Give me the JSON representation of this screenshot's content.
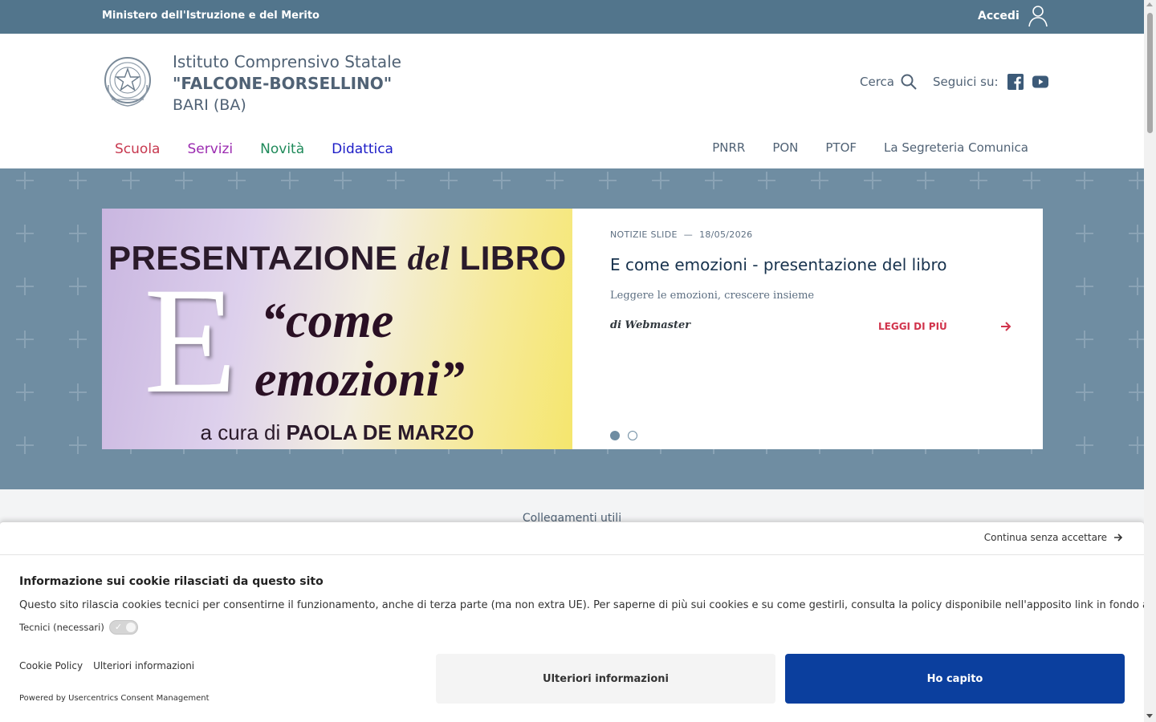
{
  "topbar": {
    "ministry": "Ministero dell'Istruzione e del Merito",
    "login_label": "Accedi"
  },
  "header": {
    "school_line1": "Istituto Comprensivo Statale",
    "school_line2": "\"FALCONE-BORSELLINO\"",
    "school_line3": "BARI (BA)",
    "search_label": "Cerca",
    "follow_label": "Seguici su:",
    "social_icons": [
      "facebook-icon",
      "youtube-icon"
    ]
  },
  "main_nav": [
    {
      "label": "Scuola",
      "color": "#c7384f"
    },
    {
      "label": "Servizi",
      "color": "#9b2bb0"
    },
    {
      "label": "Novità",
      "color": "#1f8a5a"
    },
    {
      "label": "Didattica",
      "color": "#1c1cc7"
    }
  ],
  "secondary_nav": [
    "PNRR",
    "PON",
    "PTOF",
    "La Segreteria Comunica"
  ],
  "slide": {
    "image_text": {
      "line1_a": "PRESENTAZIONE ",
      "line1_b": "del",
      "line1_c": " LIBRO",
      "big_letter": "E",
      "come": "“come",
      "emozioni": "emozioni”",
      "curated_prefix": "a cura di ",
      "curated_name": "PAOLA DE MARZO"
    },
    "category": "NOTIZIE SLIDE",
    "separator": "—",
    "date": "18/05/2026",
    "title": "E come emozioni - presentazione del libro",
    "subtitle": "Leggere le emozioni, crescere insieme",
    "author": "di Webmaster",
    "read_more": "LEGGI DI PIÙ",
    "slide_count": 2,
    "active_slide": 1
  },
  "links_band": {
    "label": "Collegamenti utili"
  },
  "cookie_banner": {
    "continue_label": "Continua senza accettare",
    "title": "Informazione sui cookie rilasciati da questo sito",
    "text": "Questo sito rilascia cookies tecnici per consentirne il funzionamento, anche di terza parte (ma non extra UE). Per saperne di più sui cookies e su come gestirli, consulta la policy disponibile nell'apposito link in fondo alla pagina.",
    "technical_label": "Tecnici (necessari)",
    "link_policy": "Cookie Policy",
    "link_more": "Ulteriori informazioni",
    "powered": "Powered by Usercentrics Consent Management",
    "button_more": "Ulteriori informazioni",
    "button_ok": "Ho capito"
  },
  "colors": {
    "topbar": "#52758c",
    "hero_bg": "#6f8da2",
    "accent_red": "#d1344c",
    "primary_button": "#0b3f9e"
  }
}
